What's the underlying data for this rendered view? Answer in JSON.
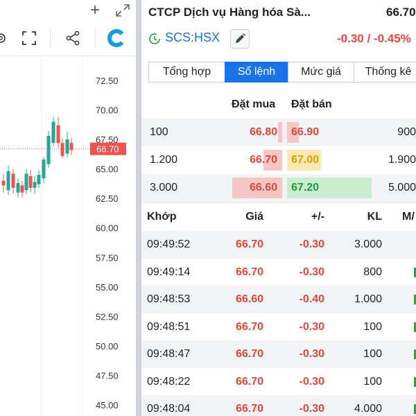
{
  "chart": {
    "y_ticks": [
      "72.50",
      "70.00",
      "67.50",
      "65.00",
      "62.50",
      "60.00",
      "57.50",
      "55.00",
      "52.50",
      "50.00",
      "47.50",
      "45.00"
    ],
    "last_price_label": "66.70",
    "colors": {
      "up": "#26a69a",
      "down": "#ef5350",
      "label_bg": "#ef5350"
    }
  },
  "chart_data": {
    "type": "candlestick",
    "y_ticks": [
      72.5,
      70.0,
      67.5,
      65.0,
      62.5,
      60.0,
      57.5,
      55.0,
      52.5,
      50.0,
      47.5,
      45.0
    ],
    "last_price": 66.7,
    "candles": [
      {
        "open": 64.0,
        "close": 63.6,
        "high": 64.6,
        "low": 63.0
      },
      {
        "open": 63.2,
        "close": 64.8,
        "high": 65.3,
        "low": 62.8
      },
      {
        "open": 64.6,
        "close": 63.4,
        "high": 65.0,
        "low": 62.9
      },
      {
        "open": 63.0,
        "close": 63.8,
        "high": 64.2,
        "low": 62.6
      },
      {
        "open": 63.6,
        "close": 63.0,
        "high": 64.0,
        "low": 62.6
      },
      {
        "open": 63.2,
        "close": 64.6,
        "high": 65.0,
        "low": 62.9
      },
      {
        "open": 64.4,
        "close": 63.4,
        "high": 64.9,
        "low": 63.0
      },
      {
        "open": 63.4,
        "close": 63.9,
        "high": 64.4,
        "low": 62.9
      },
      {
        "open": 63.7,
        "close": 64.5,
        "high": 64.9,
        "low": 63.4
      },
      {
        "open": 64.2,
        "close": 65.8,
        "high": 66.0,
        "low": 63.8
      },
      {
        "open": 65.4,
        "close": 67.8,
        "high": 68.2,
        "low": 65.1
      },
      {
        "open": 67.2,
        "close": 69.0,
        "high": 69.4,
        "low": 66.9
      },
      {
        "open": 68.7,
        "close": 67.2,
        "high": 69.4,
        "low": 66.8
      },
      {
        "open": 67.2,
        "close": 66.1,
        "high": 67.6,
        "low": 65.9
      },
      {
        "open": 66.3,
        "close": 67.5,
        "high": 68.2,
        "low": 66.0
      },
      {
        "open": 67.2,
        "close": 66.6,
        "high": 67.6,
        "low": 66.2
      }
    ]
  },
  "stock": {
    "company": "CTCP Dịch vụ Hàng hóa Sà...",
    "price": "66.70",
    "code": "SCS:HSX",
    "change": "-0.30 / -0.45%"
  },
  "tabs": [
    "Tổng hợp",
    "Sổ lệnh",
    "Mức giá",
    "Thống kê"
  ],
  "active_tab": "Sổ lệnh",
  "orderbook": {
    "header_bid": "Đặt mua",
    "header_ask": "Đặt bán",
    "rows": [
      {
        "bid_vol": "100",
        "bid_price": "66.80",
        "ask_price": "66.90",
        "ask_vol": "900",
        "bid_fill": 0.08,
        "ask_fill": 0.14,
        "ask_color": "#f5c7c4",
        "ask_text": "#e5463b"
      },
      {
        "bid_vol": "1.200",
        "bid_price": "66.70",
        "ask_price": "67.00",
        "ask_vol": "1.900",
        "bid_fill": 0.38,
        "ask_fill": 0.4,
        "ask_color": "#fbe8b0",
        "ask_text": "#d9a400"
      },
      {
        "bid_vol": "3.000",
        "bid_price": "66.60",
        "ask_price": "67.20",
        "ask_vol": "5.000",
        "bid_fill": 1.0,
        "ask_fill": 1.0,
        "ask_color": "#c9ebce",
        "ask_text": "#1f9c3e"
      }
    ]
  },
  "trades": {
    "headers": {
      "time": "Khớp",
      "price": "Giá",
      "change": "+/-",
      "volume": "KL",
      "side": "M/"
    },
    "rows": [
      {
        "time": "09:49:52",
        "price": "66.70",
        "change": "-0.30",
        "volume": "3.000"
      },
      {
        "time": "09:49:14",
        "price": "66.70",
        "change": "-0.30",
        "volume": "800"
      },
      {
        "time": "09:48:53",
        "price": "66.60",
        "change": "-0.40",
        "volume": "1.000"
      },
      {
        "time": "09:48:51",
        "price": "66.70",
        "change": "-0.30",
        "volume": "100"
      },
      {
        "time": "09:48:47",
        "price": "66.70",
        "change": "-0.30",
        "volume": "100"
      },
      {
        "time": "09:48:22",
        "price": "66.70",
        "change": "-0.30",
        "volume": "100"
      },
      {
        "time": "09:48:04",
        "price": "66.70",
        "change": "-0.30",
        "volume": "4.000"
      }
    ]
  }
}
